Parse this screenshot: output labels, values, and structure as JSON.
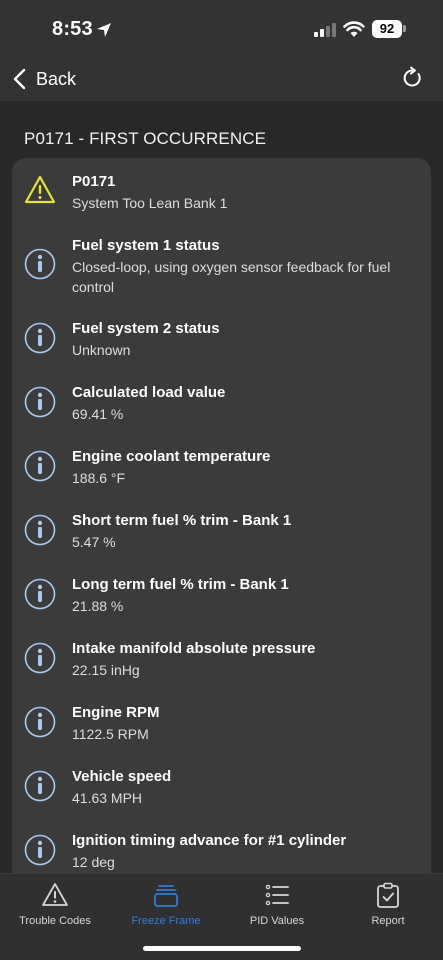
{
  "status_bar": {
    "time": "8:53",
    "battery": "92"
  },
  "nav": {
    "back_label": "Back",
    "icons": {
      "back": "chevron-left-icon",
      "refresh": "refresh-icon"
    }
  },
  "section_title": "P0171 - FIRST OCCURRENCE",
  "rows": [
    {
      "icon": "warning-icon",
      "title": "P0171",
      "value": "System Too Lean Bank 1"
    },
    {
      "icon": "info-icon",
      "title": "Fuel system 1 status",
      "value": "Closed-loop, using oxygen sensor feedback for fuel control"
    },
    {
      "icon": "info-icon",
      "title": "Fuel system 2 status",
      "value": "Unknown"
    },
    {
      "icon": "info-icon",
      "title": "Calculated load value",
      "value": "69.41 %"
    },
    {
      "icon": "info-icon",
      "title": "Engine coolant temperature",
      "value": "188.6 °F"
    },
    {
      "icon": "info-icon",
      "title": "Short term fuel % trim - Bank 1",
      "value": "5.47 %"
    },
    {
      "icon": "info-icon",
      "title": "Long term fuel % trim - Bank 1",
      "value": "21.88 %"
    },
    {
      "icon": "info-icon",
      "title": "Intake manifold absolute pressure",
      "value": "22.15 inHg"
    },
    {
      "icon": "info-icon",
      "title": "Engine RPM",
      "value": "1122.5 RPM"
    },
    {
      "icon": "info-icon",
      "title": "Vehicle speed",
      "value": "41.63 MPH"
    },
    {
      "icon": "info-icon",
      "title": "Ignition timing advance for #1 cylinder",
      "value": "12 deg"
    }
  ],
  "tabs": [
    {
      "label": "Trouble Codes",
      "icon": "warning-triangle-icon",
      "active": false
    },
    {
      "label": "Freeze Frame",
      "icon": "freeze-frame-stack-icon",
      "active": true
    },
    {
      "label": "PID Values",
      "icon": "list-icon",
      "active": false
    },
    {
      "label": "Report",
      "icon": "clipboard-check-icon",
      "active": false
    }
  ],
  "colors": {
    "background": "#282828",
    "card": "#3b3b3b",
    "accent": "#2e7bd8",
    "warning": "#e8e23a",
    "info_icon": "#a9c9f0"
  }
}
